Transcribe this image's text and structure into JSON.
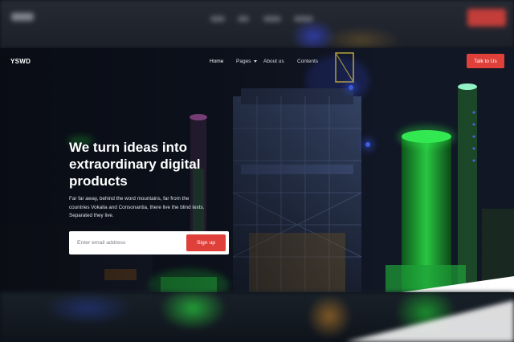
{
  "nav": {
    "brand": "YSWD",
    "links": [
      {
        "label": "Home",
        "active": true
      },
      {
        "label": "Pages",
        "dropdown": true
      },
      {
        "label": "About us"
      },
      {
        "label": "Contents"
      }
    ],
    "cta_label": "Talk to Us"
  },
  "hero": {
    "headline_lines": [
      "We turn ideas into",
      "extraordinary digital",
      "products"
    ],
    "subtext_lines": [
      "Far far away, behind the word mountains, far from the",
      "countries Vokalia and Consonantia, there live the blind texts.",
      "Separated they live."
    ],
    "email_placeholder": "Enter email address",
    "signup_label": "Sign up"
  },
  "colors": {
    "accent": "#e0403a",
    "background": "#121725",
    "text": "#ffffff",
    "glow_green": "#2cff4a",
    "glow_blue": "#3b5bff",
    "glow_pink": "#e070d8"
  }
}
